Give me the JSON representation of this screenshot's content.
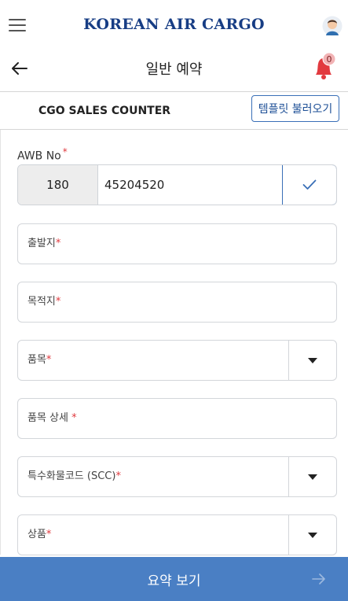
{
  "header": {
    "brand": "KOREAN AIR CARGO",
    "page_title": "일반 예약",
    "notification_count": "0"
  },
  "counter": {
    "title": "CGO SALES COUNTER",
    "template_button": "템플릿 불러오기"
  },
  "awb": {
    "label": "AWB No",
    "required_mark": "*",
    "prefix": "180",
    "number": "45204520"
  },
  "fields": [
    {
      "label": "출발지",
      "required_mark": "*",
      "has_dropdown": false
    },
    {
      "label": "목적지",
      "required_mark": "*",
      "has_dropdown": false
    },
    {
      "label": "품목",
      "required_mark": "*",
      "has_dropdown": true
    },
    {
      "label": "품목 상세 ",
      "required_mark": "*",
      "has_dropdown": false
    },
    {
      "label": "특수화물코드 (SCC)",
      "required_mark": "*",
      "has_dropdown": true
    },
    {
      "label": "상품",
      "required_mark": "*",
      "has_dropdown": true
    }
  ],
  "footer": {
    "summary_button": "요약 보기"
  },
  "colors": {
    "brand_navy": "#173d84",
    "accent_blue": "#4a7fc4",
    "required_red": "#e0393e",
    "bell_red": "#e23a3f"
  },
  "icons": [
    "menu-icon",
    "avatar-icon",
    "back-arrow-icon",
    "bell-icon",
    "check-icon",
    "chevron-down-icon",
    "arrow-right-icon"
  ]
}
